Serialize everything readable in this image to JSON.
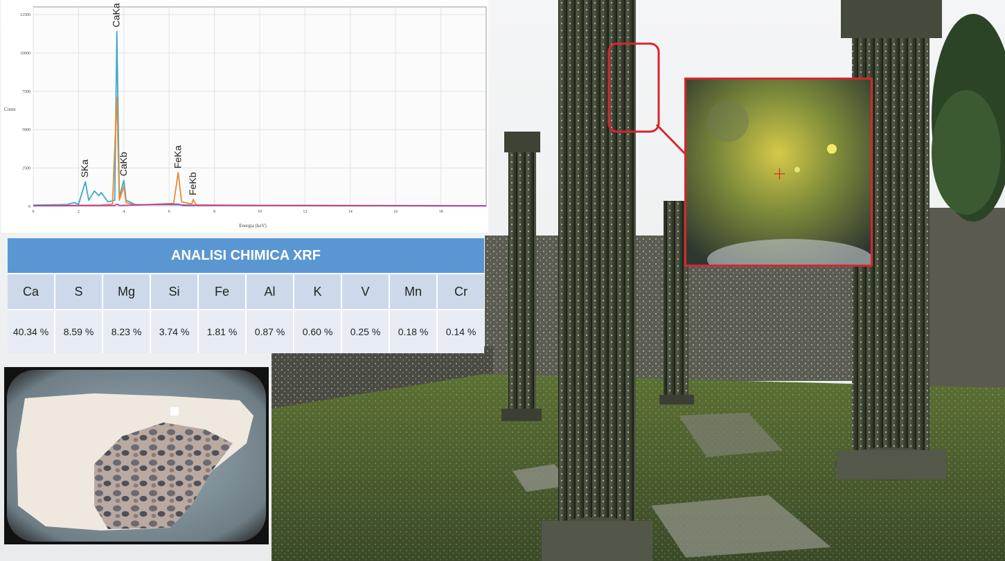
{
  "chart_data": {
    "type": "line",
    "xlabel": "Energia (keV)",
    "ylabel": "Conte",
    "xlim": [
      0,
      20
    ],
    "ylim": [
      0,
      13000
    ],
    "x_ticks": [
      0,
      2,
      4,
      6,
      8,
      10,
      12,
      14,
      16,
      18
    ],
    "y_ticks": [
      0,
      2500,
      5000,
      7500,
      10000,
      12500
    ],
    "grid": true,
    "series": [
      {
        "color": "#3ba9c9",
        "points": [
          [
            0,
            80
          ],
          [
            1.5,
            120
          ],
          [
            1.8,
            250
          ],
          [
            2.0,
            150
          ],
          [
            2.3,
            1600
          ],
          [
            2.45,
            400
          ],
          [
            2.7,
            1000
          ],
          [
            2.9,
            700
          ],
          [
            3.0,
            900
          ],
          [
            3.3,
            300
          ],
          [
            3.6,
            400
          ],
          [
            3.69,
            11400
          ],
          [
            3.8,
            600
          ],
          [
            4.0,
            1700
          ],
          [
            4.1,
            400
          ],
          [
            4.5,
            120
          ],
          [
            6.4,
            100
          ],
          [
            7.1,
            80
          ],
          [
            10,
            60
          ],
          [
            20,
            40
          ]
        ]
      },
      {
        "color": "#e8883a",
        "points": [
          [
            0,
            50
          ],
          [
            3.0,
            80
          ],
          [
            3.5,
            150
          ],
          [
            3.69,
            7100
          ],
          [
            3.8,
            400
          ],
          [
            4.0,
            1300
          ],
          [
            4.1,
            250
          ],
          [
            4.5,
            90
          ],
          [
            6.2,
            200
          ],
          [
            6.4,
            2200
          ],
          [
            6.55,
            300
          ],
          [
            7.0,
            150
          ],
          [
            7.06,
            450
          ],
          [
            7.2,
            100
          ],
          [
            10,
            70
          ],
          [
            20,
            40
          ]
        ]
      },
      {
        "color": "#b13fa8",
        "points": [
          [
            0,
            40
          ],
          [
            3.6,
            60
          ],
          [
            3.69,
            150
          ],
          [
            3.8,
            60
          ],
          [
            6.4,
            150
          ],
          [
            6.6,
            60
          ],
          [
            12,
            55
          ],
          [
            20,
            30
          ]
        ]
      }
    ],
    "annotations": [
      {
        "text": "SKa",
        "x": 2.3
      },
      {
        "text": "CaKa",
        "x": 3.69
      },
      {
        "text": "CaKb",
        "x": 4.0
      },
      {
        "text": "FeKa",
        "x": 6.4
      },
      {
        "text": "FeKb",
        "x": 7.06
      }
    ]
  },
  "xrf": {
    "title": "ANALISI CHIMICA XRF",
    "elements": [
      {
        "symbol": "Ca",
        "value": "40.34 %"
      },
      {
        "symbol": "S",
        "value": "8.59 %"
      },
      {
        "symbol": "Mg",
        "value": "8.23 %"
      },
      {
        "symbol": "Si",
        "value": "3.74 %"
      },
      {
        "symbol": "Fe",
        "value": "1.81 %"
      },
      {
        "symbol": "Al",
        "value": "0.87 %"
      },
      {
        "symbol": "K",
        "value": "0.60 %"
      },
      {
        "symbol": "V",
        "value": "0.25 %"
      },
      {
        "symbol": "Mn",
        "value": "0.18 %"
      },
      {
        "symbol": "Cr",
        "value": "0.14 %"
      }
    ]
  },
  "colors": {
    "header_blue": "#5a97d2",
    "highlight_red": "#d7262e",
    "moss_green": "#4e6b2c"
  }
}
